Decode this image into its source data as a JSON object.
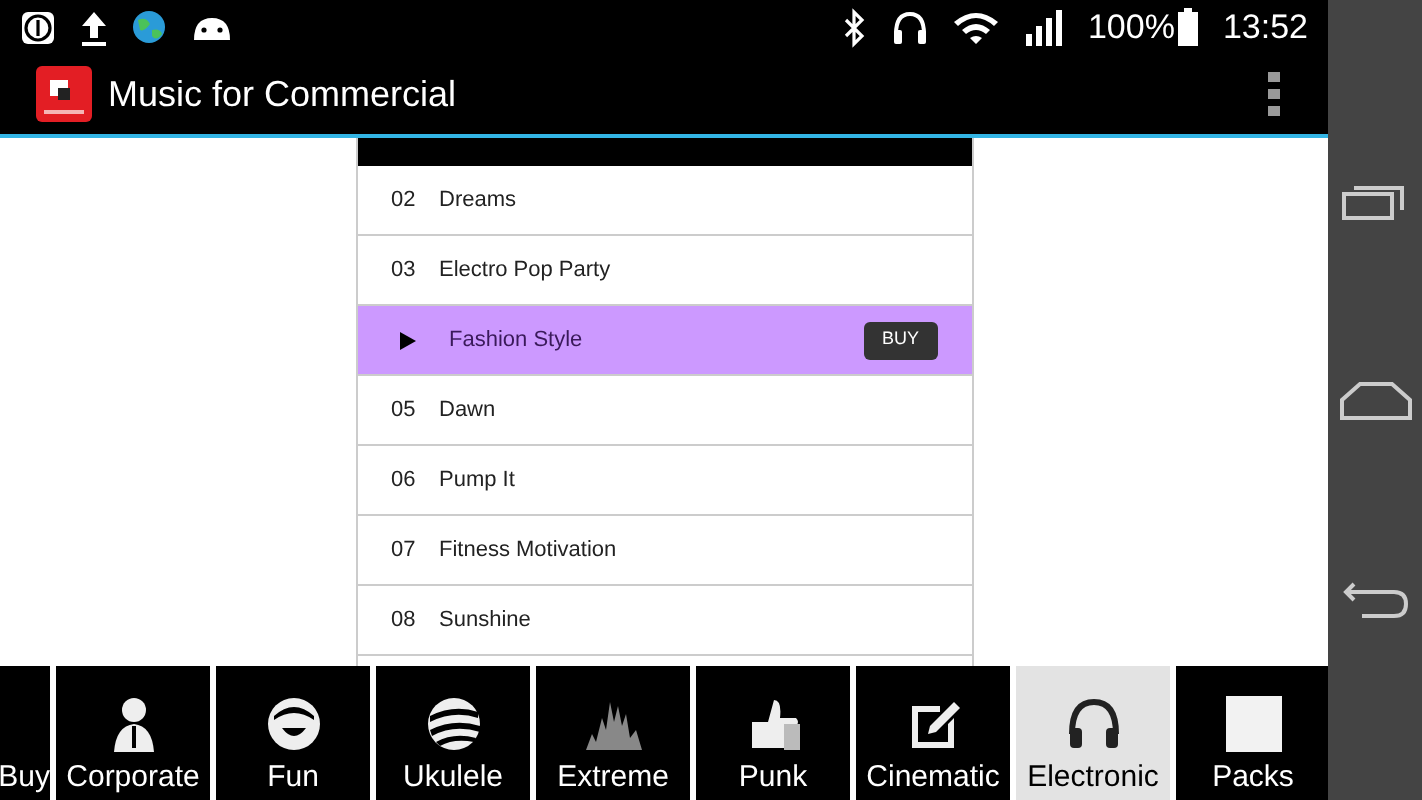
{
  "status_bar": {
    "battery": "100%",
    "time": "13:52"
  },
  "app_bar": {
    "title": "Music for Commercial"
  },
  "tracks": [
    {
      "number": "02",
      "title": "Dreams",
      "selected": false
    },
    {
      "number": "03",
      "title": "Electro Pop Party",
      "selected": false
    },
    {
      "title": "Fashion Style",
      "selected": true,
      "action": "BUY"
    },
    {
      "number": "05",
      "title": "Dawn",
      "selected": false
    },
    {
      "number": "06",
      "title": "Pump It",
      "selected": false
    },
    {
      "number": "07",
      "title": "Fitness Motivation",
      "selected": false
    },
    {
      "number": "08",
      "title": "Sunshine",
      "selected": false
    }
  ],
  "categories": [
    {
      "label": "Buy",
      "kind": "partial",
      "selected": false
    },
    {
      "label": "Corporate",
      "kind": "person",
      "selected": false
    },
    {
      "label": "Fun",
      "kind": "smile",
      "selected": false
    },
    {
      "label": "Ukulele",
      "kind": "ball",
      "selected": false
    },
    {
      "label": "Extreme",
      "kind": "wave",
      "selected": false
    },
    {
      "label": "Punk",
      "kind": "thumb",
      "selected": false
    },
    {
      "label": "Cinematic",
      "kind": "edit",
      "selected": false
    },
    {
      "label": "Electronic",
      "kind": "headphones",
      "selected": true
    },
    {
      "label": "Packs",
      "kind": "square",
      "selected": false
    }
  ]
}
